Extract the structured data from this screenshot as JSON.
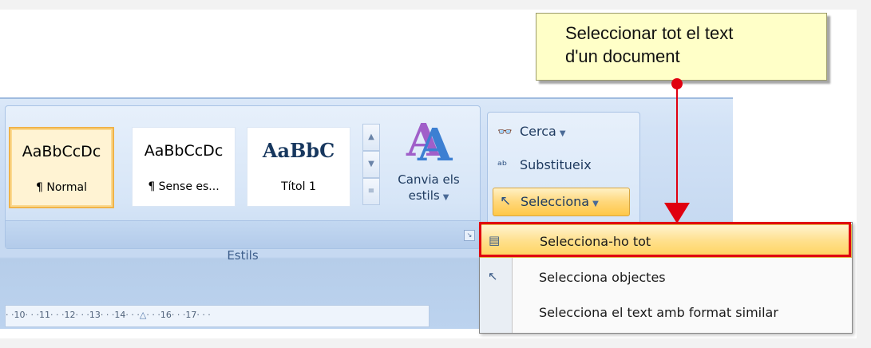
{
  "callout": {
    "line1": "Seleccionar tot el text",
    "line2": "d'un document"
  },
  "styles_group": {
    "label": "Estils",
    "tiles": [
      {
        "sample": "AaBbCcDc",
        "name": "¶ Normal",
        "selected": true
      },
      {
        "sample": "AaBbCcDc",
        "name": "¶ Sense es...",
        "selected": false
      },
      {
        "sample": "AaBbC",
        "name": "Títol 1",
        "selected": false
      }
    ],
    "change_styles": {
      "line1": "Canvia els",
      "line2": "estils"
    }
  },
  "edit_group": {
    "find": {
      "label": "Cerca",
      "icon": "binoculars-icon"
    },
    "replace": {
      "label": "Substitueix",
      "icon": "replace-icon"
    },
    "select": {
      "label": "Selecciona",
      "icon": "cursor-arrow-icon"
    }
  },
  "ruler": {
    "text": "· ·10· · ·11· · ·12· · ·13· · ·14· · ·",
    "text_after": "· · ·16· · ·17· · ·"
  },
  "menu": {
    "items": [
      {
        "label": "Selecciona-ho tot",
        "icon": "select-all-icon",
        "highlighted": true
      },
      {
        "label": "Selecciona objectes",
        "icon": "cursor-arrow-icon",
        "highlighted": false
      },
      {
        "label": "Selecciona el text amb format similar",
        "icon": "",
        "highlighted": false
      }
    ]
  },
  "colors": {
    "annotation_red": "#e00010",
    "callout_bg": "#ffffc8",
    "highlight_gold": "#ffd35e",
    "ribbon_blue": "#c6d9f1"
  }
}
